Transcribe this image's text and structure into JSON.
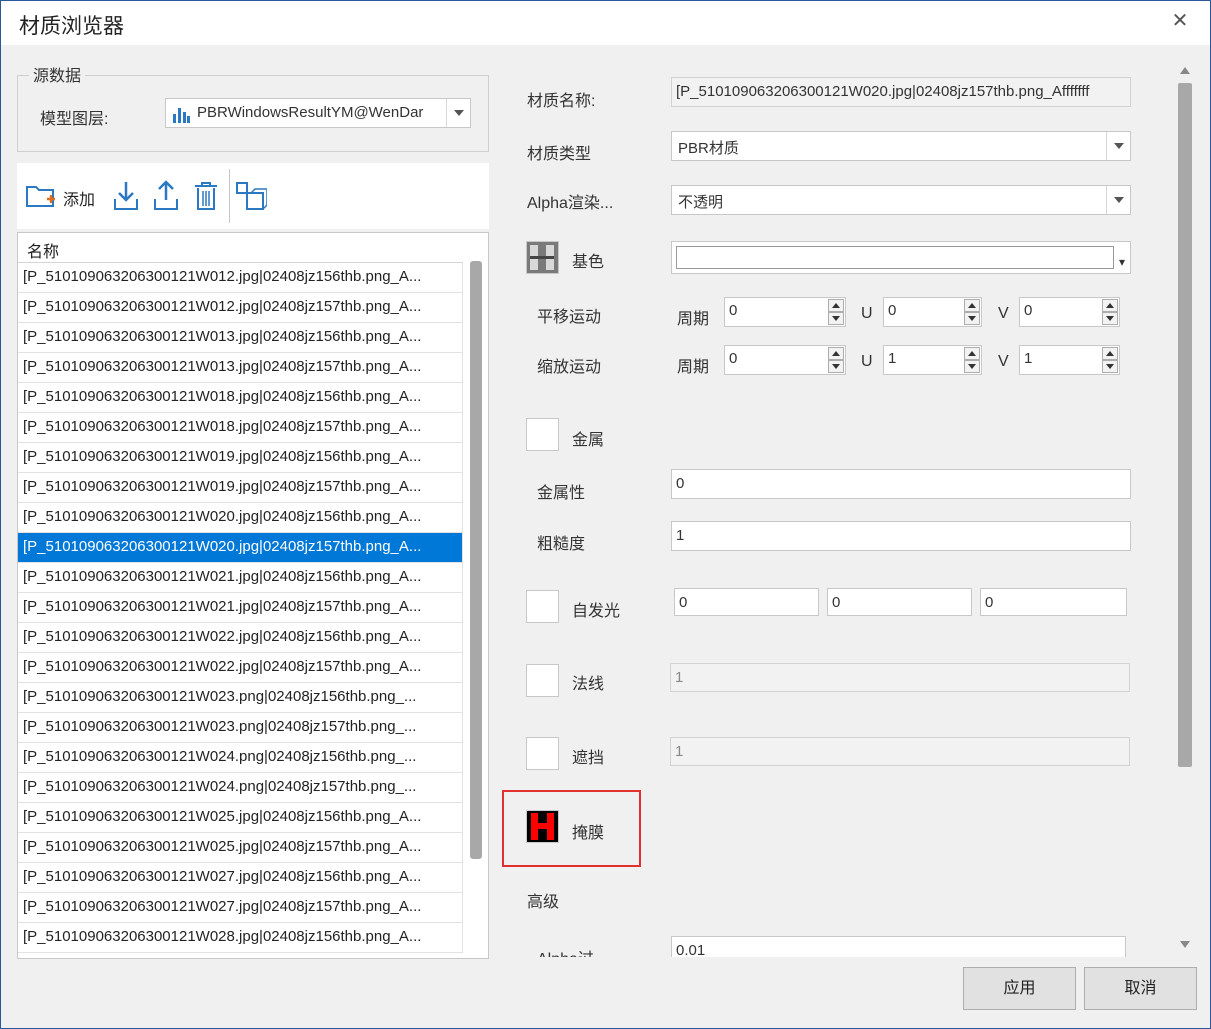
{
  "window": {
    "title": "材质浏览器"
  },
  "source": {
    "group_label": "源数据",
    "layer_label": "模型图层:",
    "layer_value": "PBRWindowsResultYM@WenDar"
  },
  "toolbar": {
    "add_label": "添加"
  },
  "list": {
    "header": "名称",
    "selected_index": 9,
    "items": [
      "[P_510109063206300121W012.jpg|02408jz156thb.png_A...",
      "[P_510109063206300121W012.jpg|02408jz157thb.png_A...",
      "[P_510109063206300121W013.jpg|02408jz156thb.png_A...",
      "[P_510109063206300121W013.jpg|02408jz157thb.png_A...",
      "[P_510109063206300121W018.jpg|02408jz156thb.png_A...",
      "[P_510109063206300121W018.jpg|02408jz157thb.png_A...",
      "[P_510109063206300121W019.jpg|02408jz156thb.png_A...",
      "[P_510109063206300121W019.jpg|02408jz157thb.png_A...",
      "[P_510109063206300121W020.jpg|02408jz156thb.png_A...",
      "[P_510109063206300121W020.jpg|02408jz157thb.png_A...",
      "[P_510109063206300121W021.jpg|02408jz156thb.png_A...",
      "[P_510109063206300121W021.jpg|02408jz157thb.png_A...",
      "[P_510109063206300121W022.jpg|02408jz156thb.png_A...",
      "[P_510109063206300121W022.jpg|02408jz157thb.png_A...",
      "[P_510109063206300121W023.png|02408jz156thb.png_...",
      "[P_510109063206300121W023.png|02408jz157thb.png_...",
      "[P_510109063206300121W024.png|02408jz156thb.png_...",
      "[P_510109063206300121W024.png|02408jz157thb.png_...",
      "[P_510109063206300121W025.jpg|02408jz156thb.png_A...",
      "[P_510109063206300121W025.jpg|02408jz157thb.png_A...",
      "[P_510109063206300121W027.jpg|02408jz156thb.png_A...",
      "[P_510109063206300121W027.jpg|02408jz157thb.png_A...",
      "[P_510109063206300121W028.jpg|02408jz156thb.png_A..."
    ]
  },
  "props": {
    "name_label": "材质名称:",
    "name_value": "[P_510109063206300121W020.jpg|02408jz157thb.png_Afffffff",
    "type_label": "材质类型",
    "type_value": "PBR材质",
    "alpha_label": "Alpha渲染...",
    "alpha_value": "不透明",
    "base_color_label": "基色",
    "translate_label": "平移运动",
    "scale_label": "缩放运动",
    "period_label": "周期",
    "u_label": "U",
    "v_label": "V",
    "translate_period": "0",
    "translate_u": "0",
    "translate_v": "0",
    "scale_period": "0",
    "scale_u": "1",
    "scale_v": "1",
    "metal_label": "金属",
    "metallic_label": "金属性",
    "metallic_value": "0",
    "roughness_label": "粗糙度",
    "roughness_value": "1",
    "emissive_label": "自发光",
    "emissive_1": "0",
    "emissive_2": "0",
    "emissive_3": "0",
    "normal_label": "法线",
    "normal_value": "1",
    "occlusion_label": "遮挡",
    "occlusion_value": "1",
    "mask_label": "掩膜",
    "advanced_label": "高级",
    "alpha_cutoff_label": "Alpha过",
    "alpha_cutoff_value": "0.01"
  },
  "colors": {
    "selection": "#0078d7",
    "highlight_border": "#e03030",
    "mask_red": "#ff0000"
  },
  "buttons": {
    "apply": "应用",
    "cancel": "取消"
  }
}
